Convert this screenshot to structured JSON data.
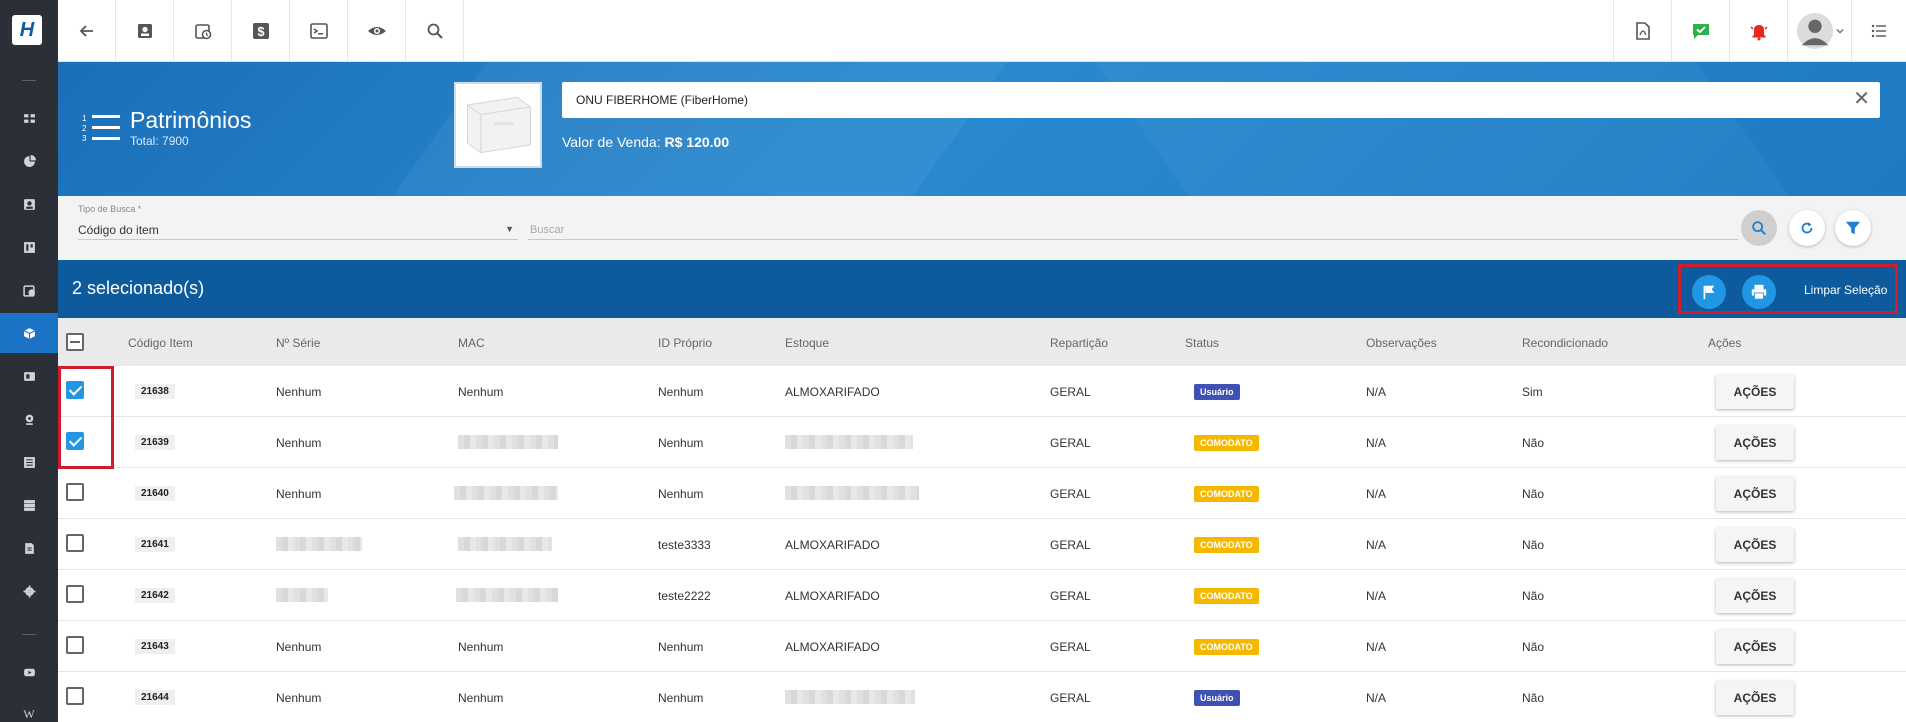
{
  "sidebar": {
    "items": [
      {
        "icon": "dashboard-icon"
      },
      {
        "icon": "pie-chart-icon"
      },
      {
        "icon": "contact-icon"
      },
      {
        "icon": "board-icon"
      },
      {
        "icon": "schedule-icon"
      },
      {
        "icon": "box-icon",
        "active": true
      },
      {
        "icon": "card-icon"
      },
      {
        "icon": "location-icon"
      },
      {
        "icon": "list-icon"
      },
      {
        "icon": "server-icon"
      },
      {
        "icon": "document-icon"
      },
      {
        "icon": "gear-icon"
      },
      {
        "icon": "youtube-icon"
      },
      {
        "icon": "wiki-icon",
        "text": "W"
      }
    ]
  },
  "header": {
    "title": "Patrimônios",
    "total": "Total: 7900",
    "product_name": "ONU FIBERHOME  (FiberHome)",
    "price_label": "Valor de Venda:",
    "price_value": "R$ 120.00",
    "close_glyph": "✕"
  },
  "search": {
    "type_label": "Tipo de Busca *",
    "type_value": "Código do item",
    "placeholder": "Buscar"
  },
  "selection": {
    "count_text": "2 selecionado(s)",
    "clear_label": "Limpar Seleção"
  },
  "table": {
    "headers": [
      "Código Item",
      "Nº Série",
      "MAC",
      "ID Próprio",
      "Estoque",
      "Repartição",
      "Status",
      "Observações",
      "Recondicionado",
      "Ações"
    ],
    "rows": [
      {
        "codigo": "21638",
        "serie": "Nenhum",
        "mac": "Nenhum",
        "id_proprio": "Nenhum",
        "estoque": "ALMOXARIFADO",
        "reparticao": "GERAL",
        "status": "Usuário",
        "obs": "N/A",
        "recond": "Sim",
        "acoes": "AÇÕES",
        "checked": true
      },
      {
        "codigo": "21639",
        "serie": "Nenhum",
        "mac": "",
        "id_proprio": "Nenhum",
        "estoque": "",
        "reparticao": "GERAL",
        "status": "COMODATO",
        "obs": "N/A",
        "recond": "Não",
        "acoes": "AÇÕES",
        "checked": true
      },
      {
        "codigo": "21640",
        "serie": "Nenhum",
        "mac": "",
        "id_proprio": "Nenhum",
        "estoque": "",
        "reparticao": "GERAL",
        "status": "COMODATO",
        "obs": "N/A",
        "recond": "Não",
        "acoes": "AÇÕES",
        "checked": false
      },
      {
        "codigo": "21641",
        "serie": "",
        "mac": "",
        "id_proprio": "teste3333",
        "estoque": "ALMOXARIFADO",
        "reparticao": "GERAL",
        "status": "COMODATO",
        "obs": "N/A",
        "recond": "Não",
        "acoes": "AÇÕES",
        "checked": false
      },
      {
        "codigo": "21642",
        "serie": "",
        "mac": "",
        "id_proprio": "teste2222",
        "estoque": "ALMOXARIFADO",
        "reparticao": "GERAL",
        "status": "COMODATO",
        "obs": "N/A",
        "recond": "Não",
        "acoes": "AÇÕES",
        "checked": false
      },
      {
        "codigo": "21643",
        "serie": "Nenhum",
        "mac": "Nenhum",
        "id_proprio": "Nenhum",
        "estoque": "ALMOXARIFADO",
        "reparticao": "GERAL",
        "status": "COMODATO",
        "obs": "N/A",
        "recond": "Não",
        "acoes": "AÇÕES",
        "checked": false
      },
      {
        "codigo": "21644",
        "serie": "Nenhum",
        "mac": "Nenhum",
        "id_proprio": "Nenhum",
        "estoque": "",
        "reparticao": "GERAL",
        "status": "Usuário",
        "obs": "N/A",
        "recond": "Não",
        "acoes": "AÇÕES",
        "checked": false
      }
    ]
  },
  "colors": {
    "status_usuario": "#3f51b5",
    "status_comodato": "#f5b800",
    "selection_bar": "#0d5a9c",
    "accent": "#2196e3"
  }
}
